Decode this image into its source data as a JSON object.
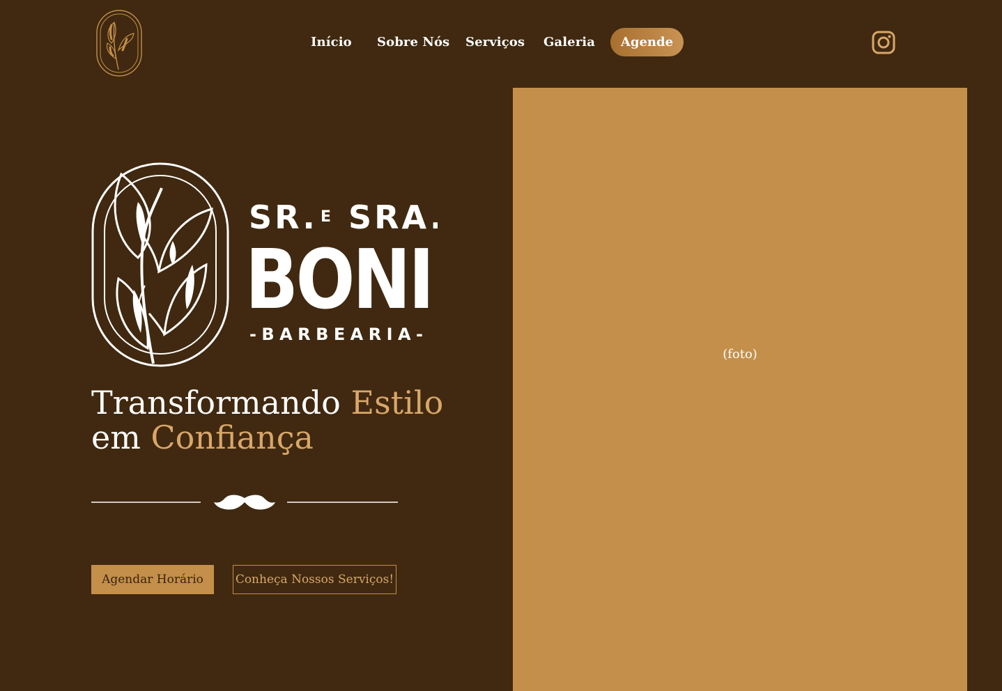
{
  "nav": {
    "logo_icon": "leaf-logo-icon",
    "links": [
      "Início",
      "Sobre Nós",
      "Serviços",
      "Galeria"
    ],
    "cta_label": "Agende",
    "social_icon": "instagram-icon"
  },
  "brand": {
    "logo": "SR. E SRA. BONI -BARBEARIA-"
  },
  "hero": {
    "headline_part1": "Transformando ",
    "headline_accent1": "Estilo",
    "headline_part2": "em ",
    "headline_accent2": "Confiança",
    "divider_icon": "mustache-icon",
    "primary_button": "Agendar Horário",
    "secondary_button": "Conheça Nossos Serviços!"
  },
  "photo": {
    "placeholder": "(foto)"
  },
  "colors": {
    "background": "#402910",
    "accent": "#c48f4a",
    "accent_text": "#d8a769",
    "text": "#ffffff"
  }
}
